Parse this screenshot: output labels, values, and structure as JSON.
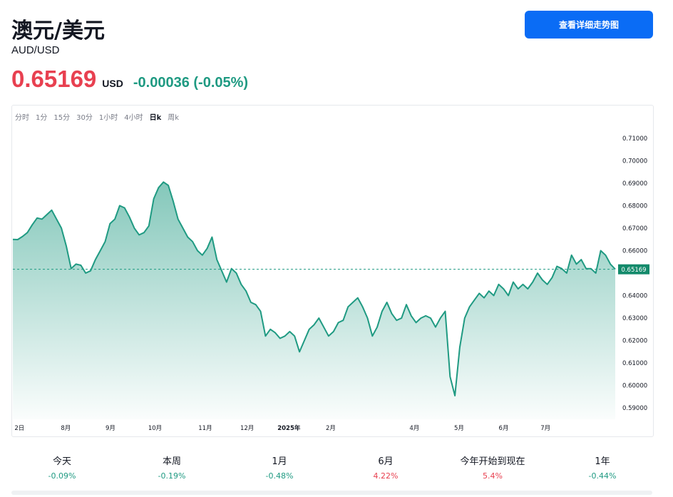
{
  "header": {
    "title": "澳元/美元",
    "subtitle": "AUD/USD",
    "price": "0.65169",
    "currency": "USD",
    "change": "-0.00036 (-0.05%)",
    "detail_button": "查看详细走势图"
  },
  "colors": {
    "price": "#e84050",
    "change": "#1f9a82",
    "line": "#1f9a82",
    "button": "#0a6cf5",
    "last_price_badge": "#138a6b"
  },
  "intervals": [
    "分时",
    "1分",
    "15分",
    "30分",
    "1小时",
    "4小时",
    "日k",
    "周k"
  ],
  "active_interval": "日k",
  "chart_data": {
    "type": "area",
    "xlabel": "",
    "ylabel": "",
    "ylim": [
      0.585,
      0.715
    ],
    "x_tick_labels": [
      "2日",
      "8月",
      "9月",
      "10月",
      "11月",
      "12月",
      "2025年",
      "2月",
      "4月",
      "5月",
      "6月",
      "7月"
    ],
    "y_tick_labels": [
      "0.71000",
      "0.70000",
      "0.69000",
      "0.68000",
      "0.67000",
      "0.66000",
      "0.64000",
      "0.63000",
      "0.62000",
      "0.61000",
      "0.60000",
      "0.59000"
    ],
    "last_price_label": "0.65169",
    "last_price": 0.65169,
    "series": [
      {
        "values": [
          0.665,
          0.6649,
          0.6663,
          0.668,
          0.6715,
          0.6745,
          0.674,
          0.676,
          0.678,
          0.674,
          0.67,
          0.662,
          0.652,
          0.654,
          0.6535,
          0.65,
          0.651,
          0.656,
          0.66,
          0.664,
          0.672,
          0.674,
          0.68,
          0.679,
          0.675,
          0.67,
          0.667,
          0.668,
          0.671,
          0.683,
          0.688,
          0.6905,
          0.689,
          0.682,
          0.674,
          0.67,
          0.666,
          0.664,
          0.66,
          0.658,
          0.661,
          0.666,
          0.656,
          0.651,
          0.646,
          0.652,
          0.65,
          0.645,
          0.642,
          0.637,
          0.636,
          0.633,
          0.622,
          0.625,
          0.6235,
          0.621,
          0.622,
          0.624,
          0.622,
          0.615,
          0.62,
          0.625,
          0.627,
          0.63,
          0.626,
          0.622,
          0.624,
          0.628,
          0.629,
          0.635,
          0.637,
          0.639,
          0.635,
          0.63,
          0.622,
          0.626,
          0.633,
          0.637,
          0.632,
          0.629,
          0.63,
          0.636,
          0.631,
          0.628,
          0.63,
          0.631,
          0.63,
          0.626,
          0.63,
          0.633,
          0.604,
          0.5955,
          0.617,
          0.63,
          0.635,
          0.638,
          0.641,
          0.639,
          0.642,
          0.64,
          0.645,
          0.643,
          0.64,
          0.646,
          0.643,
          0.645,
          0.643,
          0.646,
          0.65,
          0.647,
          0.645,
          0.648,
          0.653,
          0.652,
          0.65,
          0.658,
          0.654,
          0.656,
          0.652,
          0.652,
          0.65,
          0.66,
          0.658,
          0.654,
          0.6517
        ]
      }
    ]
  },
  "performance": [
    {
      "label": "今天",
      "value": "-0.09%",
      "dir": "neg"
    },
    {
      "label": "本周",
      "value": "-0.19%",
      "dir": "neg"
    },
    {
      "label": "1月",
      "value": "-0.48%",
      "dir": "neg"
    },
    {
      "label": "6月",
      "value": "4.22%",
      "dir": "pos"
    },
    {
      "label": "今年开始到现在",
      "value": "5.4%",
      "dir": "pos"
    },
    {
      "label": "1年",
      "value": "-0.44%",
      "dir": "neg"
    }
  ]
}
